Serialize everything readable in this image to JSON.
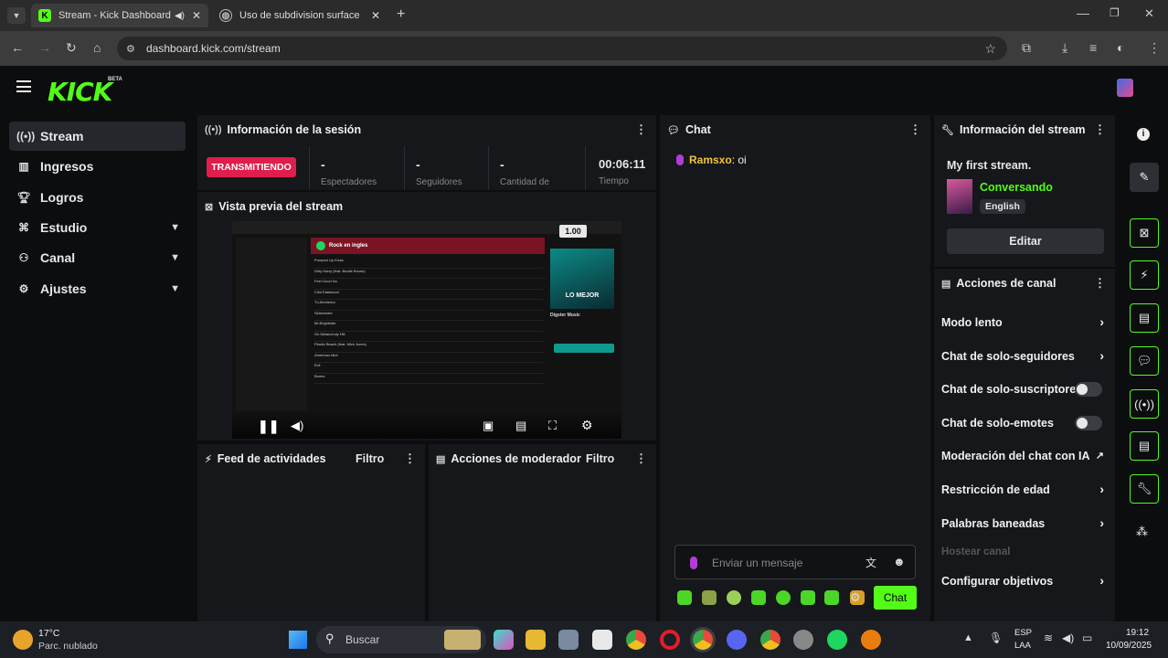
{
  "browser": {
    "tabs": [
      {
        "title": "Stream - Kick Dashboard",
        "active": true
      },
      {
        "title": "Uso de subdivision surface",
        "active": false
      }
    ],
    "url": "dashboard.kick.com/stream"
  },
  "app": {
    "logo": "KICK",
    "beta": "BETA",
    "accent": "#53fc18",
    "sidebar": [
      {
        "label": "Stream",
        "icon": "broadcast-icon"
      },
      {
        "label": "Ingresos",
        "icon": "chart-icon"
      },
      {
        "label": "Logros",
        "icon": "trophy-icon"
      },
      {
        "label": "Estudio",
        "icon": "studio-icon"
      },
      {
        "label": "Canal",
        "icon": "channel-icon"
      },
      {
        "label": "Ajustes",
        "icon": "gear-icon"
      }
    ]
  },
  "session": {
    "title": "Información de la sesión",
    "status": "TRANSMITIENDO",
    "stats": [
      "-",
      "-",
      "-"
    ],
    "stat_labels": [
      "Espectadores",
      "Seguidores",
      "Cantidad de"
    ],
    "time": "00:06:11",
    "time_label": "Tiempo"
  },
  "preview": {
    "title": "Vista previa del stream",
    "rate": "1.00",
    "inner": {
      "playlist": "Rock en ingles",
      "banner": "LO MEJOR",
      "card_title": "Digster Music",
      "songs": [
        "Pumped Up Kicks",
        "Dirty Harry (feat. Bootie Brown)",
        "Feel Good Inc.",
        "Clint Eastwood",
        "Tú Alrededor",
        "Sidewinder",
        "Mr.Brightside",
        "On Melancholy Hill",
        "Plastic Beach (feat. Mick Jones)",
        "American Idiot",
        "Evil",
        "Bones"
      ]
    }
  },
  "feed": {
    "title": "Feed de actividades",
    "filter": "Filtro"
  },
  "mod": {
    "title": "Acciones de moderador",
    "filter": "Filtro"
  },
  "chat": {
    "title": "Chat",
    "messages": [
      {
        "user": "Ramsxo",
        "text": ": oi"
      }
    ],
    "placeholder": "Enviar un mensaje",
    "send": "Chat"
  },
  "stream_info": {
    "title": "Información del stream",
    "stream_title": "My first stream.",
    "category": "Conversando",
    "language": "English",
    "edit": "Editar"
  },
  "channel_actions": {
    "title": "Acciones de canal",
    "items": [
      {
        "label": "Modo lento",
        "control": "chevron"
      },
      {
        "label": "Chat de solo-seguidores",
        "control": "chevron"
      },
      {
        "label": "Chat de solo-suscriptores",
        "control": "toggle"
      },
      {
        "label": "Chat de solo-emotes",
        "control": "toggle"
      },
      {
        "label": "Moderación del chat con IA",
        "control": "external"
      },
      {
        "label": "Restricción de edad",
        "control": "chevron"
      },
      {
        "label": "Palabras baneadas",
        "control": "chevron"
      },
      {
        "label": "Hostear canal",
        "control": "disabled"
      },
      {
        "label": "Configurar objetivos",
        "control": "chevron"
      }
    ]
  },
  "taskbar": {
    "weather_temp": "17°C",
    "weather_desc": "Parc. nublado",
    "search": "Buscar",
    "lang1": "ESP",
    "lang2": "LAA",
    "time": "19:12",
    "date": "10/09/2025"
  }
}
